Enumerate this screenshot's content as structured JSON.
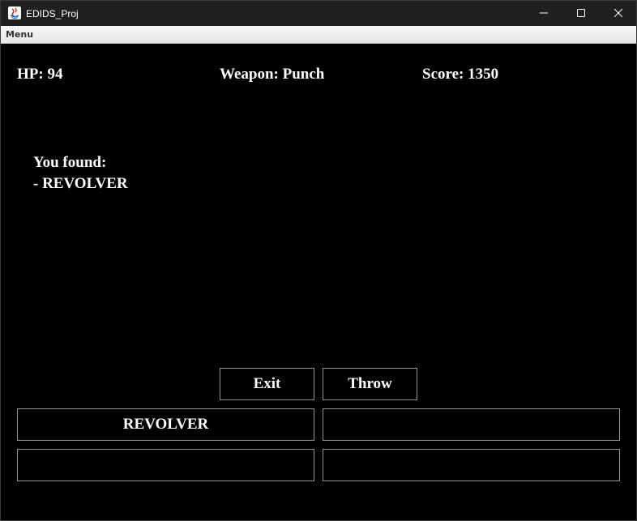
{
  "window": {
    "title": "EDIDS_Proj",
    "icon": "java-app-icon",
    "controls": [
      "minimize-icon",
      "maximize-icon",
      "close-icon"
    ]
  },
  "menubar": {
    "items": [
      {
        "label": "Menu"
      }
    ]
  },
  "status": {
    "hp": "HP: 94",
    "weapon": "Weapon: Punch",
    "score": "Score: 1350"
  },
  "message": {
    "lines": [
      "You found:",
      "- REVOLVER"
    ]
  },
  "actions": {
    "exit_label": "Exit",
    "throw_label": "Throw"
  },
  "inventory": {
    "slots": [
      {
        "label": "REVOLVER"
      },
      {
        "label": ""
      },
      {
        "label": ""
      },
      {
        "label": ""
      }
    ]
  },
  "colors": {
    "background": "#000000",
    "text": "#ffffff",
    "button_border": "#8a94a3",
    "titlebar": "#202020"
  }
}
